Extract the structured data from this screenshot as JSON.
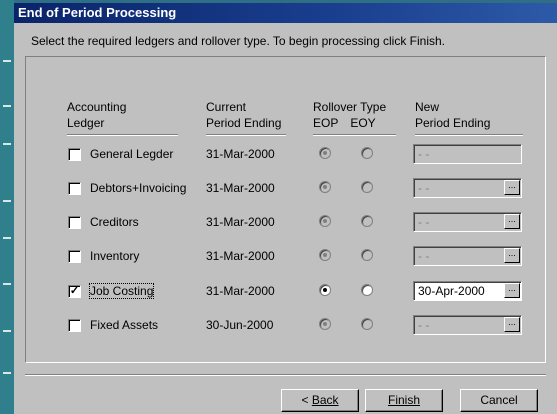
{
  "dialog": {
    "title": "End of Period Processing",
    "instruction": "Select the required ledgers and rollover type. To begin processing click Finish."
  },
  "headers": {
    "ledger": [
      "Accounting",
      "Ledger"
    ],
    "current": [
      "Current",
      "Period Ending"
    ],
    "rollover": "Rollover Type",
    "eop": "EOP",
    "eoy": "EOY",
    "newperiod": [
      "New",
      "Period Ending"
    ]
  },
  "rows": [
    {
      "label": "General Legder",
      "current": "31-Mar-2000",
      "new": " -  -",
      "checked": false,
      "eop": true,
      "eoy": false,
      "enabled": false,
      "has_dropdown": false
    },
    {
      "label": "Debtors+Invoicing",
      "current": "31-Mar-2000",
      "new": " -  -",
      "checked": false,
      "eop": true,
      "eoy": false,
      "enabled": false,
      "has_dropdown": true
    },
    {
      "label": "Creditors",
      "current": "31-Mar-2000",
      "new": " -  -",
      "checked": false,
      "eop": true,
      "eoy": false,
      "enabled": false,
      "has_dropdown": true
    },
    {
      "label": "Inventory",
      "current": "31-Mar-2000",
      "new": " -  -",
      "checked": false,
      "eop": true,
      "eoy": false,
      "enabled": false,
      "has_dropdown": true
    },
    {
      "label": "Job Costing",
      "current": "31-Mar-2000",
      "new": "30-Apr-2000",
      "checked": true,
      "eop": true,
      "eoy": false,
      "enabled": true,
      "has_dropdown": true
    },
    {
      "label": "Fixed Assets",
      "current": "30-Jun-2000",
      "new": " -  -",
      "checked": false,
      "eop": true,
      "eoy": false,
      "enabled": false,
      "has_dropdown": true
    }
  ],
  "buttons": {
    "back": "Back",
    "finish": "Finish",
    "cancel": "Cancel",
    "ellipsis": "..."
  },
  "checkmark": "✓"
}
